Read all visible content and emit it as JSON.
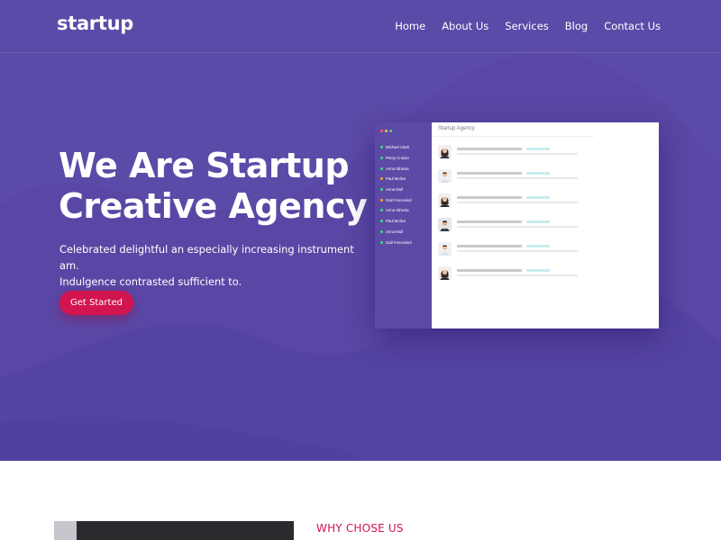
{
  "brand": {
    "logo": "startup"
  },
  "nav": [
    "Home",
    "About Us",
    "Services",
    "Blog",
    "Contact Us"
  ],
  "hero": {
    "title": [
      "We Are Startup",
      "Creative Agency"
    ],
    "description": [
      "Celebrated delightful an especially increasing instrument am.",
      "Indulgence contrasted sufficient to."
    ],
    "cta": "Get Started"
  },
  "mockup": {
    "title": "Startup Agency",
    "window_dots": [
      "#ff5f6d",
      "#ffbd44",
      "#4dd77b"
    ],
    "contacts": [
      {
        "name": "Michael Clark",
        "status": "#3ddc84"
      },
      {
        "name": "Petey Cruiser",
        "status": "#3ddc84"
      },
      {
        "name": "Anna Sthesia",
        "status": "#3ddc84"
      },
      {
        "name": "Paul Molive",
        "status": "#f5a623"
      },
      {
        "name": "Anna Mull",
        "status": "#3ddc84"
      },
      {
        "name": "Gail Forcewind",
        "status": "#f5a623"
      },
      {
        "name": "Anna Sthesia",
        "status": "#3ddc84"
      },
      {
        "name": "Paul Molive",
        "status": "#3ddc84"
      },
      {
        "name": "Anna Mull",
        "status": "#3ddc84"
      },
      {
        "name": "Gail Forcewind",
        "status": "#3ddc84"
      }
    ],
    "messages": [
      {
        "avatar": "woman"
      },
      {
        "avatar": "man-light"
      },
      {
        "avatar": "woman"
      },
      {
        "avatar": "man-dark"
      },
      {
        "avatar": "man-light"
      },
      {
        "avatar": "woman"
      }
    ]
  },
  "section": {
    "kicker": "WHY CHOSE US"
  },
  "colors": {
    "hero_bg": "#5a47a5",
    "accent": "#d2144f",
    "mock_sidebar": "#5c4aa6"
  }
}
